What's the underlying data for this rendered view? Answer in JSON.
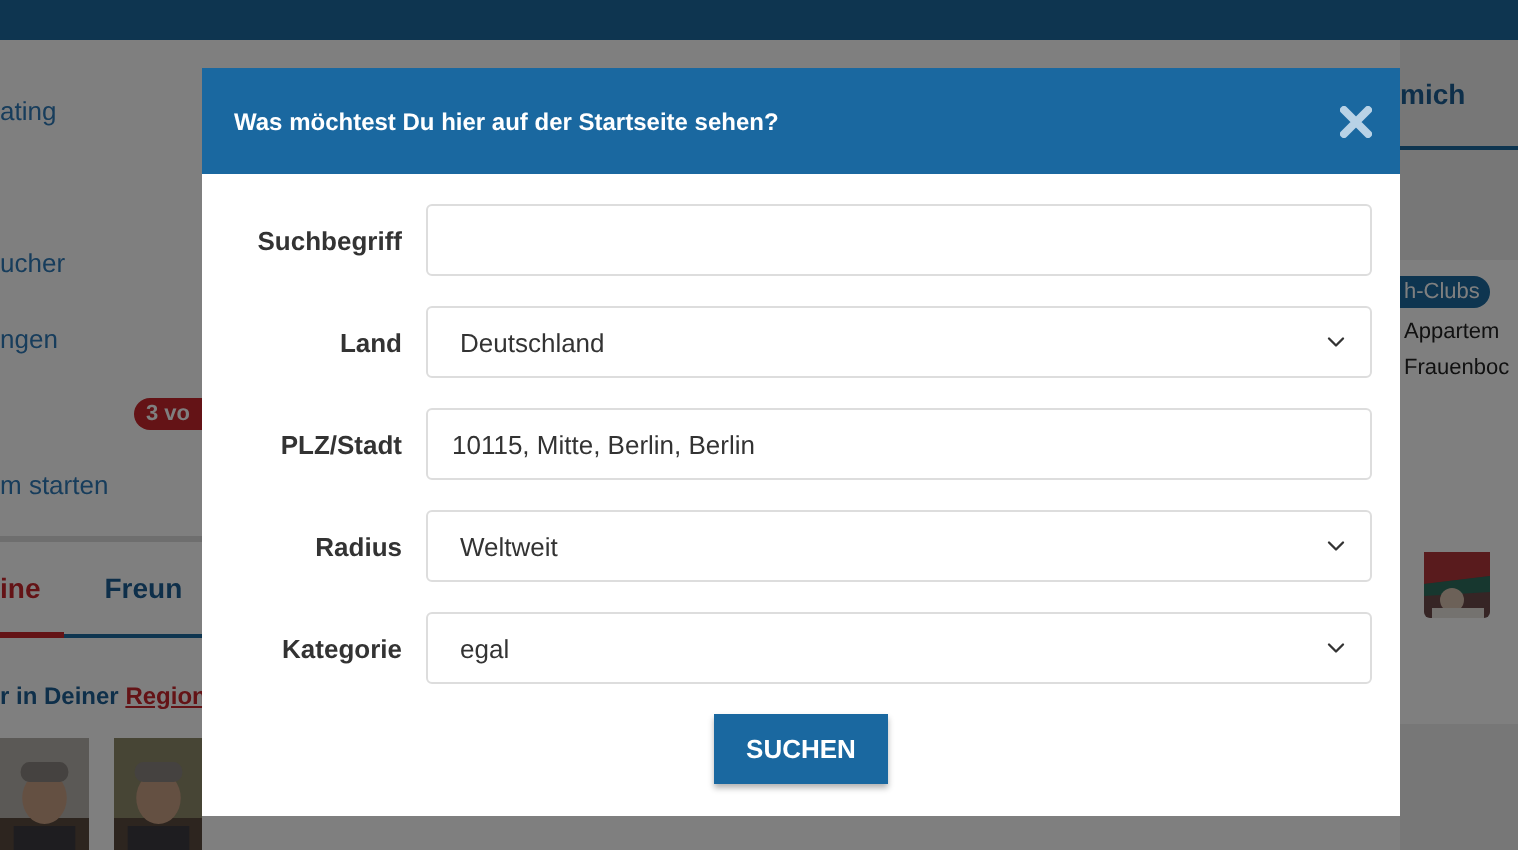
{
  "page": {
    "sidebar": {
      "items": [
        {
          "label": "ating"
        },
        {
          "label": "ucher"
        },
        {
          "label": "ngen"
        },
        {
          "label": "m starten"
        }
      ],
      "badge": "3 vo"
    },
    "tabs": [
      {
        "label": "ine",
        "selected": true
      },
      {
        "label": "Freun",
        "selected": false
      }
    ],
    "region_note": {
      "text": "r in Deiner ",
      "link": "Region"
    },
    "right_tab": {
      "label": "mich",
      "selected": true
    },
    "card": {
      "badge": "h-Clubs",
      "lines": [
        "Appartem",
        "Frauenboc"
      ]
    }
  },
  "dialog": {
    "title": "Was möchtest Du hier auf der Startseite sehen?",
    "fields": [
      {
        "label": "Suchbegriff",
        "kind": "text"
      },
      {
        "label": "Land",
        "kind": "select",
        "value": "Deutschland"
      },
      {
        "label": "PLZ/Stadt",
        "kind": "text",
        "value": "10115, Mitte, Berlin, Berlin"
      },
      {
        "label": "Radius",
        "kind": "select",
        "value": "Weltweit"
      },
      {
        "label": "Kategorie",
        "kind": "select",
        "value": "egal"
      }
    ],
    "button": "SUCHEN"
  }
}
